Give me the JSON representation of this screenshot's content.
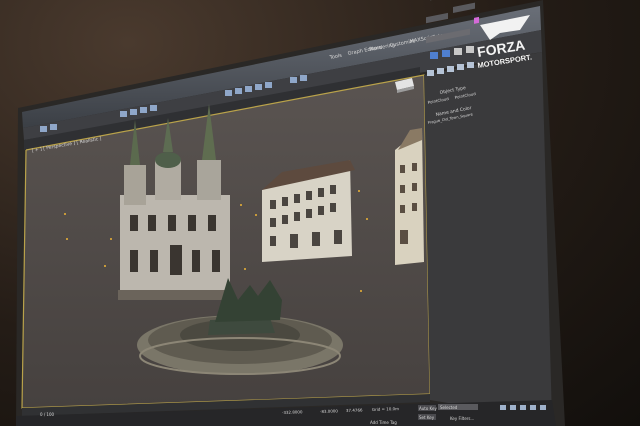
{
  "app": {
    "brand_line1": "FORZA",
    "brand_line2": "MOTORSPORT."
  },
  "menu": {
    "items": [
      "Tools",
      "Graph Editors",
      "Rendering",
      "Customize",
      "MAXScript",
      "Help"
    ]
  },
  "command_panel": {
    "rollout_title": "Object Type",
    "buttons": [
      "PointCloud",
      "PointCloud"
    ],
    "section_title": "Name and Color",
    "name_value": "Prague_Old_Town_Square"
  },
  "viewport": {
    "label": "[ + ] [ Perspective ] [ Realistic ]"
  },
  "timeline": {
    "frame_counter": "0 / 100",
    "coords": {
      "x": "-332.8000",
      "y": "-83.0000",
      "z": "37.4766"
    },
    "grid": "Grid = 10.0m",
    "auto_key": "Auto Key",
    "set_key": "Set Key",
    "selected": "Selected",
    "key_filters": "Key Filters...",
    "add_time_tag": "Add Time Tag"
  },
  "colors": {
    "accent_blue": "#2a6fd6",
    "ui_gray": "#3c3c3c",
    "viewport_bg": "#5b5450"
  },
  "icons": [
    "maximize-icon",
    "close-icon",
    "undo-icon",
    "redo-icon",
    "select-icon",
    "move-icon",
    "rotate-icon",
    "scale-icon",
    "render-icon",
    "teapot-icon",
    "play-icon",
    "key-icon"
  ]
}
